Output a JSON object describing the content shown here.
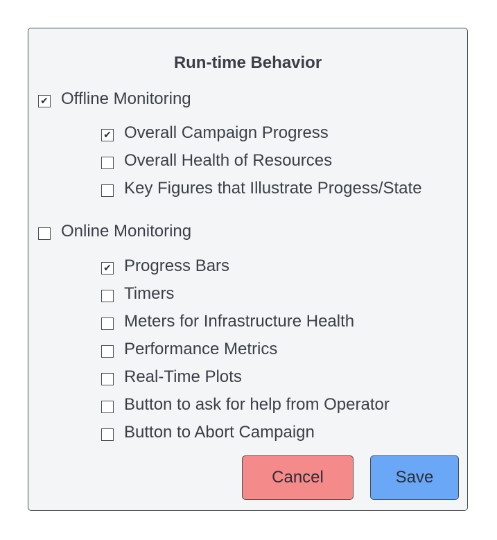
{
  "dialog": {
    "title": "Run-time Behavior",
    "sections": [
      {
        "label": "Offline Monitoring",
        "checked": true,
        "items": [
          {
            "label": "Overall Campaign Progress",
            "checked": true
          },
          {
            "label": "Overall Health of Resources",
            "checked": false
          },
          {
            "label": "Key Figures that Illustrate Progess/State",
            "checked": false
          }
        ]
      },
      {
        "label": "Online Monitoring",
        "checked": false,
        "items": [
          {
            "label": "Progress Bars",
            "checked": true
          },
          {
            "label": "Timers",
            "checked": false
          },
          {
            "label": "Meters for Infrastructure Health",
            "checked": false
          },
          {
            "label": "Performance Metrics",
            "checked": false
          },
          {
            "label": "Real-Time Plots",
            "checked": false
          },
          {
            "label": "Button to ask for help from Operator",
            "checked": false
          },
          {
            "label": "Button to Abort Campaign",
            "checked": false
          }
        ]
      }
    ],
    "buttons": {
      "cancel_label": "Cancel",
      "save_label": "Save"
    }
  },
  "colors": {
    "cancel_button": "#f58a8a",
    "save_button": "#6aa8f7",
    "panel_background": "#f4f5f6",
    "border": "#4a4e55"
  },
  "icons": {
    "checked": "check-mark-icon"
  }
}
